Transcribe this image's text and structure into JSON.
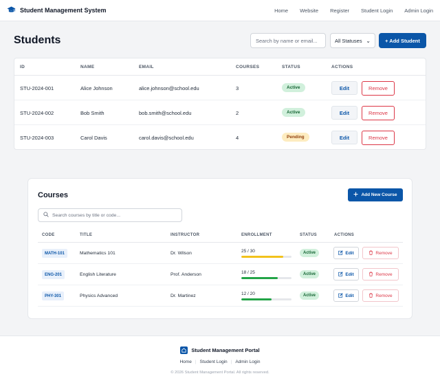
{
  "nav": {
    "title": "Student Management System",
    "links": [
      "Home",
      "Website",
      "Register",
      "Student Login",
      "Admin Login"
    ]
  },
  "students": {
    "title": "Students",
    "search_placeholder": "Search by name or email...",
    "status_filter": "All Statuses",
    "add_label": "+ Add Student",
    "columns": [
      "ID",
      "NAME",
      "EMAIL",
      "COURSES",
      "STATUS",
      "ACTIONS"
    ],
    "rows": [
      {
        "id": "STU-2024-001",
        "name": "Alice Johnson",
        "email": "alice.johnson@school.edu",
        "courses": "3",
        "status": "Active"
      },
      {
        "id": "STU-2024-002",
        "name": "Bob Smith",
        "email": "bob.smith@school.edu",
        "courses": "2",
        "status": "Active"
      },
      {
        "id": "STU-2024-003",
        "name": "Carol Davis",
        "email": "carol.davis@school.edu",
        "courses": "4",
        "status": "Pending"
      }
    ],
    "edit_label": "Edit",
    "remove_label": "Remove"
  },
  "courses": {
    "title": "Courses",
    "add_label": "Add New Course",
    "search_placeholder": "Search courses by title or code...",
    "columns": [
      "CODE",
      "TITLE",
      "INSTRUCTOR",
      "ENROLLMENT",
      "STATUS",
      "ACTIONS"
    ],
    "rows": [
      {
        "code": "MATH-101",
        "title": "Mathematics 101",
        "instructor": "Dr. Wilson",
        "enrollment": "25 / 30",
        "enrolled": 25,
        "capacity": 30,
        "bar_color": "#f2c21b",
        "status": "Active"
      },
      {
        "code": "ENG-201",
        "title": "English Literature",
        "instructor": "Prof. Anderson",
        "enrollment": "18 / 25",
        "enrolled": 18,
        "capacity": 25,
        "bar_color": "#22a447",
        "status": "Active"
      },
      {
        "code": "PHY-301",
        "title": "Physics Advanced",
        "instructor": "Dr. Martinez",
        "enrollment": "12 / 20",
        "enrolled": 12,
        "capacity": 20,
        "bar_color": "#22a447",
        "status": "Active"
      }
    ],
    "edit_label": "Edit",
    "remove_label": "Remove"
  },
  "footer": {
    "title": "Student Management Portal",
    "links": [
      "Home",
      "Student Login",
      "Admin Login"
    ],
    "copyright": "© 2026 Student Management Portal. All rights reserved."
  },
  "colors": {
    "primary": "#0b56a8",
    "danger": "#dc3545",
    "active_bg": "#d1f0dc",
    "pending_bg": "#fdecc0"
  }
}
